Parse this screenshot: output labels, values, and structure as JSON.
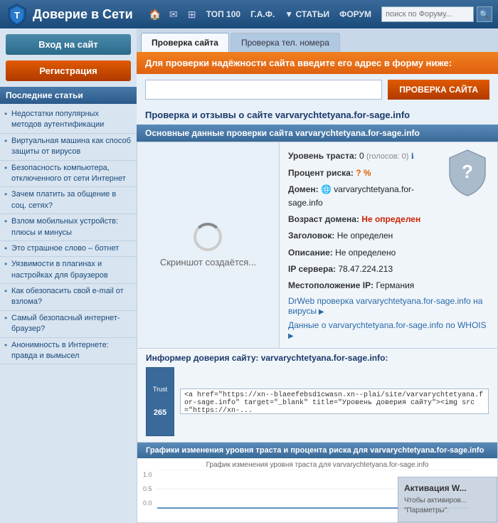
{
  "site_title": "Доверие в Сети",
  "nav": {
    "home_icon": "🏠",
    "mail_icon": "✉",
    "grid_icon": "⊞",
    "top100_label": "ТОП 100",
    "faq_label": "Г.А.Ф.",
    "articles_label": "▼ СТАТЬИ",
    "forum_label": "ФОРУМ",
    "search_placeholder": "поиск по Форуму...",
    "search_icon": "🔍"
  },
  "sidebar": {
    "login_label": "Вход на сайт",
    "register_label": "Регистрация",
    "recent_title": "Последние статьи",
    "articles": [
      "Недостатки популярных методов аутентификации",
      "Виртуальная машина как способ защиты от вирусов",
      "Безопасность компьютера, отключенного от сети Интернет",
      "Зачем платить за общение в соц. сетях?",
      "Взлом мобильных устройств: плюсы и минусы",
      "Это страшное слово – ботнет",
      "Уязвимости в плагинах и настройках для браузеров",
      "Как обезопасить свой e-mail от взлома?",
      "Самый безопасный интернет-браузер?",
      "Анонимность в Интернете: правда и вымысел"
    ]
  },
  "tabs": {
    "check_site": "Проверка сайта",
    "check_phone": "Проверка тел. номера"
  },
  "orange_banner": "Для проверки надёжности сайта введите его адрес в форму ниже:",
  "url_input_placeholder": "",
  "check_site_btn": "ПРОВЕРКА САЙТА",
  "result": {
    "title": "Проверка и отзывы о сайте varvarychtetyana.for-sage.info",
    "section_header": "Основные данные проверки сайта varvarychtetyana.for-sage.info",
    "screenshot_text": "Скриншот создаётся...",
    "trust_level_label": "Уровень траста:",
    "trust_level_value": "0",
    "trust_level_suffix": "(голосов: 0)",
    "percent_label": "Процент риска:",
    "percent_value": "? %",
    "domain_label": "Домен:",
    "domain_icon": "🌐",
    "domain_value": "varvarychtetyana.for-sage.info",
    "age_label": "Возраст домена:",
    "age_value": "Не определен",
    "headline_label": "Заголовок:",
    "headline_value": "Не определен",
    "description_label": "Описание:",
    "description_value": "Не определено",
    "ip_label": "IP сервера:",
    "ip_value": "78.47.224.213",
    "location_label": "Местоположение IP:",
    "location_value": "Германия",
    "drweb_link": "DrWeb проверка varvarychtetyana.for-sage.info на вирусы",
    "whois_link": "Данные о varvarychtetyana.for-sage.info по WHOIS"
  },
  "informer": {
    "header": "Информер доверия сайту: varvarychtetyana.for-sage.info:",
    "badge_line1": "Trust",
    "badge_line2": "265",
    "code": "<a href=\"https://xn--blaeefebsd1cwasn.xn--plai/site/varvarychtetyana.for-sage.info\" target=\"_blank\" title=\"Уровень доверия сайту\"><img src=\"https://xn-..."
  },
  "graph": {
    "header": "Графики изменения уровня траста и процента риска для varvarychtetyana.for-sage.info",
    "chart_title": "График изменения уровня траста для varvarychtetyana.for-sage.info",
    "y_labels": [
      "1.0",
      "0.5",
      "0.0"
    ]
  },
  "activation": {
    "title": "Активация W...",
    "body": "Чтобы активиров...\n\"Параметры\"."
  }
}
